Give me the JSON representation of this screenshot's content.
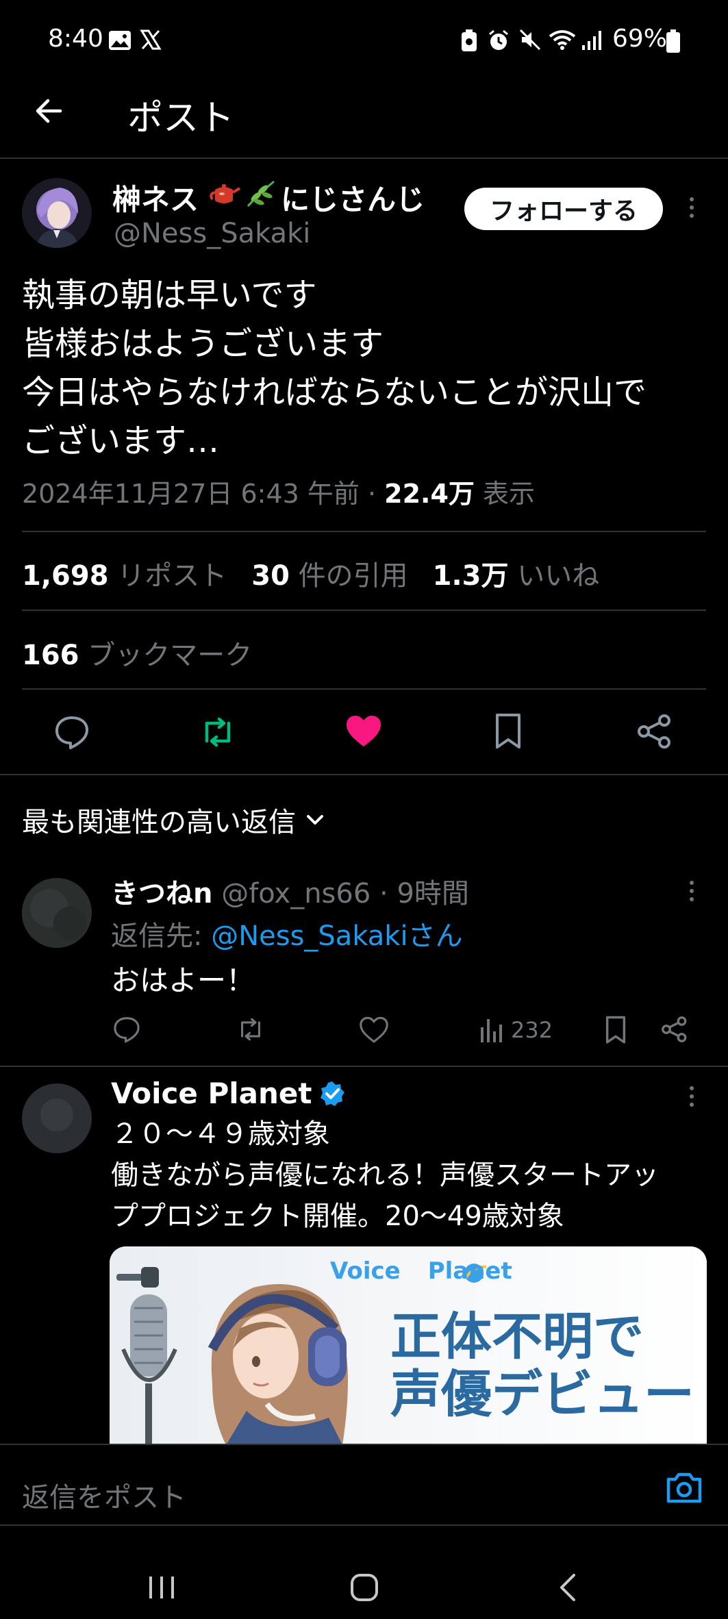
{
  "status": {
    "time": "8:40",
    "battery": "69%"
  },
  "header": {
    "title": "ポスト"
  },
  "post": {
    "author_name": "榊ネス",
    "author_suffix": "にじさんじ",
    "handle": "@Ness_Sakaki",
    "follow_label": "フォローする",
    "lines": [
      "執事の朝は早いです",
      "皆様おはようございます",
      "今日はやらなければならないことが沢山で",
      "ございます…"
    ],
    "timestamp": "2024年11月27日 6:43 午前 · ",
    "views_count": "22.4万",
    "views_label": " 表示",
    "stats": {
      "reposts_count": "1,698",
      "reposts_label": "リポスト",
      "quotes_count": "30",
      "quotes_label": "件の引用",
      "likes_count": "1.3万",
      "likes_label": "いいね",
      "bookmarks_count": "166",
      "bookmarks_label": "ブックマーク"
    }
  },
  "replies_sort": {
    "label": "最も関連性の高い返信"
  },
  "replies": [
    {
      "name": "きつねn",
      "handle": "@fox_ns66",
      "time": "· 9時間",
      "reply_to_prefix": "返信先: ",
      "reply_to": "@Ness_Sakakiさん",
      "text": "おはよー！",
      "views": "232"
    }
  ],
  "ad": {
    "name": "Voice Planet",
    "line1": "２０～４９歳対象",
    "line2": "働きながら声優になれる！声優スタートアッ",
    "line3": "ププロジェクト開催。20～49歳対象",
    "banner_brand_left": "Voice",
    "banner_brand_right": "Planet",
    "banner_text1": "正体不明で",
    "banner_text2": "声優デビュー"
  },
  "composer": {
    "placeholder": "返信をポスト"
  },
  "colors": {
    "accent": "#1d9bf0",
    "like": "#f91880",
    "repost": "#00ba7c",
    "text": "#e7e9ea",
    "muted": "#71767b",
    "divider": "#2f3336"
  }
}
